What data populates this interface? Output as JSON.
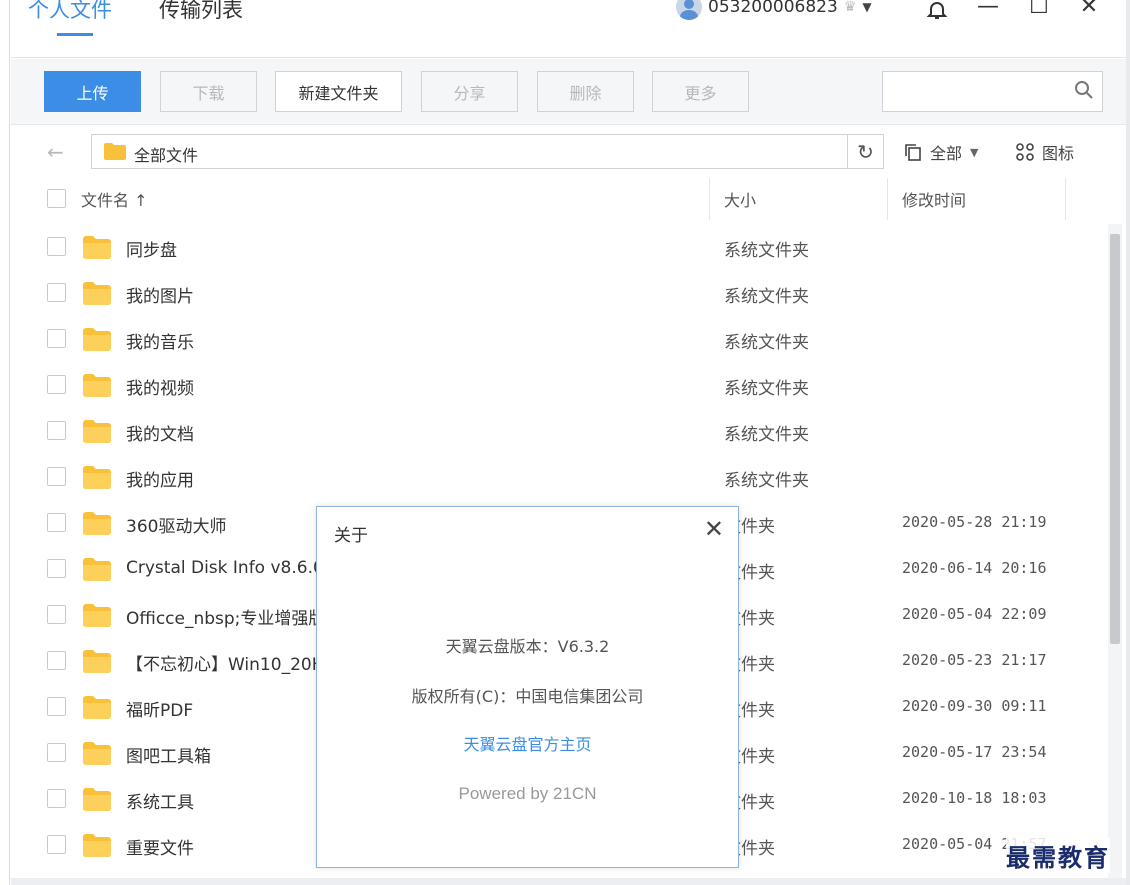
{
  "tabs": [
    {
      "label": "个人文件",
      "active": true
    },
    {
      "label": "传输列表",
      "active": false
    }
  ],
  "user": {
    "name": "053200006823"
  },
  "window_controls": {
    "bell": "bell-icon",
    "minimize": "—",
    "maximize": "☐",
    "close": "✕"
  },
  "toolbar": {
    "upload": "上传",
    "download": "下载",
    "new_folder": "新建文件夹",
    "share": "分享",
    "delete": "删除",
    "more": "更多",
    "search_placeholder": ""
  },
  "path": {
    "current": "全部文件"
  },
  "filter": {
    "label": "全部"
  },
  "view": {
    "label": "图标"
  },
  "columns": {
    "name": "文件名 ↑",
    "size": "大小",
    "modified": "修改时间"
  },
  "files": [
    {
      "name": "同步盘",
      "size": "系统文件夹",
      "modified": ""
    },
    {
      "name": "我的图片",
      "size": "系统文件夹",
      "modified": ""
    },
    {
      "name": "我的音乐",
      "size": "系统文件夹",
      "modified": ""
    },
    {
      "name": "我的视频",
      "size": "系统文件夹",
      "modified": ""
    },
    {
      "name": "我的文档",
      "size": "系统文件夹",
      "modified": ""
    },
    {
      "name": "我的应用",
      "size": "系统文件夹",
      "modified": ""
    },
    {
      "name": "360驱动大师",
      "size": "文件夹",
      "modified": "2020-05-28 21:19"
    },
    {
      "name": "Crystal Disk Info v8.6.0",
      "size": "文件夹",
      "modified": "2020-06-14 20:16"
    },
    {
      "name": "Officce_nbsp;专业增强版",
      "size": "文件夹",
      "modified": "2020-05-04 22:09"
    },
    {
      "name": "【不忘初心】Win10_20H2",
      "size": "文件夹",
      "modified": "2020-05-23 21:17"
    },
    {
      "name": "福昕PDF",
      "size": "文件夹",
      "modified": "2020-09-30 09:11"
    },
    {
      "name": "图吧工具箱",
      "size": "文件夹",
      "modified": "2020-05-17 23:54"
    },
    {
      "name": "系统工具",
      "size": "文件夹",
      "modified": "2020-10-18 18:03"
    },
    {
      "name": "重要文件",
      "size": "文件夹",
      "modified": "2020-05-04 21:57"
    }
  ],
  "dialog": {
    "title": "关于",
    "version": "天翼云盘版本：V6.3.2",
    "copyright": "版权所有(C)：中国电信集团公司",
    "homepage_link": "天翼云盘官方主页",
    "powered": "Powered by 21CN"
  },
  "watermark": "最需教育",
  "colors": {
    "accent": "#3c8de6",
    "folder": "#f9c13a"
  }
}
